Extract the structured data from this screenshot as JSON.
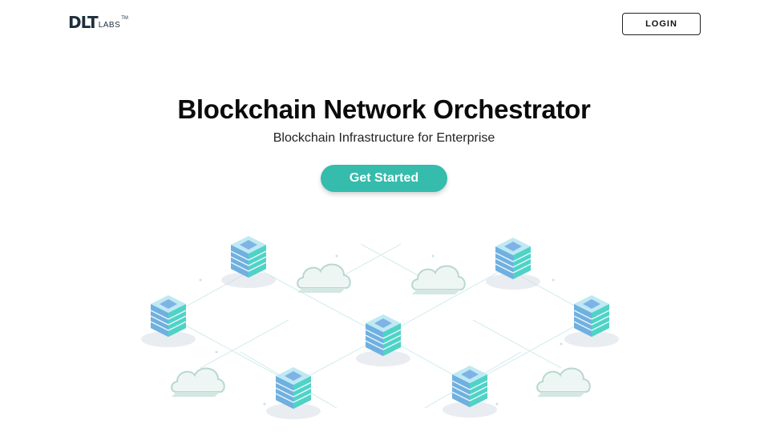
{
  "header": {
    "logo_main": "DLT",
    "logo_sub": "LABS",
    "logo_tm": "TM",
    "login_label": "LOGIN"
  },
  "hero": {
    "title": "Blockchain Network Orchestrator",
    "subtitle": "Blockchain Infrastructure for Enterprise",
    "cta_label": "Get Started"
  },
  "colors": {
    "accent": "#35bcac",
    "logo": "#1f2e3d",
    "server_teal": "#4fd3c6",
    "server_blue": "#7fb3e6"
  },
  "illustration": {
    "icons": [
      "server-stack-icon",
      "cloud-icon"
    ]
  }
}
